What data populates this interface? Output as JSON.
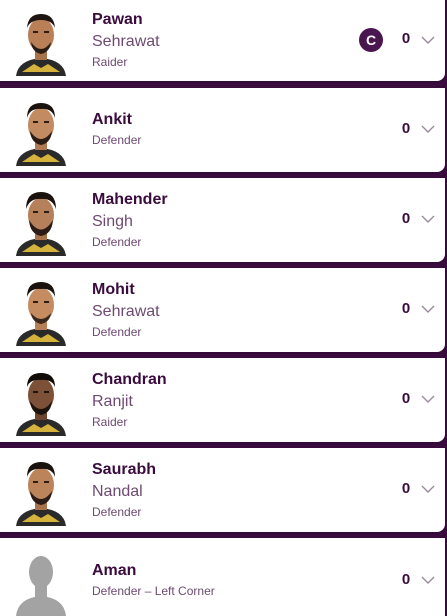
{
  "colors": {
    "background": "#3a0c3e",
    "card": "#ffffff",
    "name_primary": "#3a0c3e",
    "name_secondary": "#6e4a72",
    "captain_badge": "#4a1650",
    "jersey_gold": "#d4b23c"
  },
  "players": [
    {
      "first": "Pawan",
      "last": "Sehrawat",
      "role": "Raider",
      "points": "0",
      "captain_label": "C",
      "photo": "player-photo"
    },
    {
      "first": "Ankit",
      "last": "",
      "role": "Defender",
      "points": "0",
      "photo": "player-photo"
    },
    {
      "first": "Mahender",
      "last": "Singh",
      "role": "Defender",
      "points": "0",
      "photo": "player-photo"
    },
    {
      "first": "Mohit",
      "last": "Sehrawat",
      "role": "Defender",
      "points": "0",
      "photo": "player-photo"
    },
    {
      "first": "Chandran",
      "last": "Ranjit",
      "role": "Raider",
      "points": "0",
      "photo": "player-photo"
    },
    {
      "first": "Saurabh",
      "last": "Nandal",
      "role": "Defender",
      "points": "0",
      "photo": "player-photo"
    },
    {
      "first": "Aman",
      "last": "",
      "role": "Defender – Left Corner",
      "points": "0",
      "photo": "placeholder-silhouette"
    }
  ],
  "icons": {
    "expand": "chevron-down-icon",
    "captain": "captain-badge-icon"
  }
}
